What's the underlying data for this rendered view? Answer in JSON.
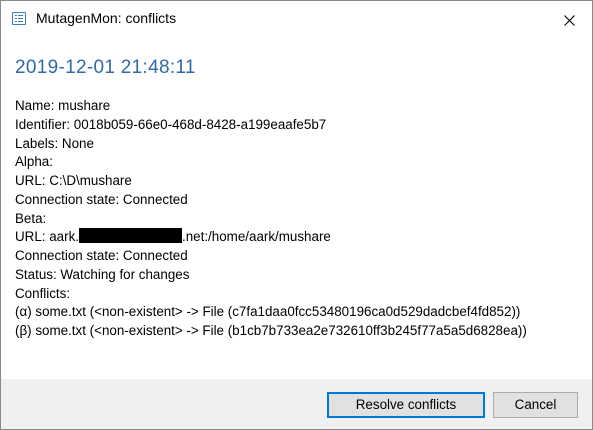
{
  "window": {
    "title": "MutagenMon: conflicts",
    "icon": "list-window-icon",
    "close_icon": "close-icon"
  },
  "heading": "2019-12-01 21:48:11",
  "details": {
    "name": "Name: mushare",
    "identifier": "Identifier: 0018b059-66e0-468d-8428-a199eaafe5b7",
    "labels": "Labels: None",
    "alpha_header": "Alpha:",
    "alpha_url": "URL: C:\\D\\mushare",
    "alpha_connection": "Connection state: Connected",
    "beta_header": "Beta:",
    "beta_url_prefix": "URL: aark.",
    "beta_url_suffix": ".net:/home/aark/mushare",
    "beta_connection": "Connection state: Connected",
    "status": "Status: Watching for changes",
    "conflicts_header": "Conflicts:",
    "conflicts": [
      "(α) some.txt (<non-existent> -> File (c7fa1daa0fcc53480196ca0d529dadcbef4fd852))",
      "(β) some.txt (<non-existent> -> File (b1cb7b733ea2e732610ff3b245f77a5a5d6828ea))"
    ]
  },
  "buttons": {
    "resolve_label": "Resolve conflicts",
    "cancel_label": "Cancel"
  },
  "colors": {
    "heading": "#2f6aa8",
    "primary_border": "#0078d7",
    "footer_bg": "#f0f0f0",
    "button_bg": "#e1e1e1"
  }
}
